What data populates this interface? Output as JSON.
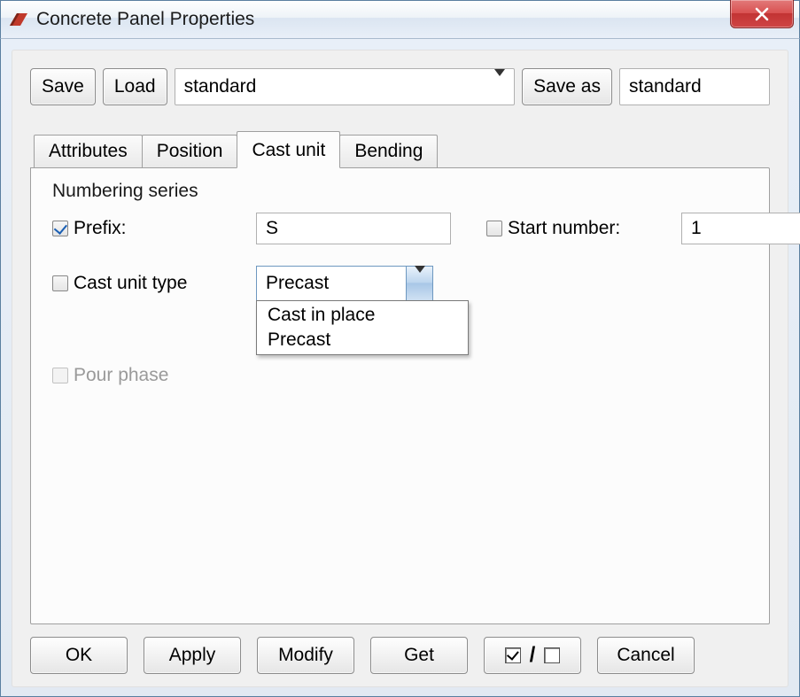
{
  "window": {
    "title": "Concrete Panel Properties"
  },
  "toolbar": {
    "save": "Save",
    "load": "Load",
    "preset_selected": "standard",
    "save_as": "Save as",
    "save_as_name": "standard"
  },
  "tabs": {
    "attributes": "Attributes",
    "position": "Position",
    "cast_unit": "Cast unit",
    "bending": "Bending",
    "active": "cast_unit"
  },
  "group": {
    "title": "Numbering series",
    "prefix": {
      "checked": true,
      "label": "Prefix:",
      "value": "S"
    },
    "start_number": {
      "checked": false,
      "label": "Start number:",
      "value": "1"
    },
    "cast_unit_type": {
      "checked": false,
      "label": "Cast unit type",
      "value": "Precast",
      "options": [
        "Cast in place",
        "Precast"
      ]
    },
    "pour_phase": {
      "enabled": false,
      "checked": false,
      "label": "Pour phase"
    }
  },
  "buttons": {
    "ok": "OK",
    "apply": "Apply",
    "modify": "Modify",
    "get": "Get",
    "cancel": "Cancel"
  }
}
